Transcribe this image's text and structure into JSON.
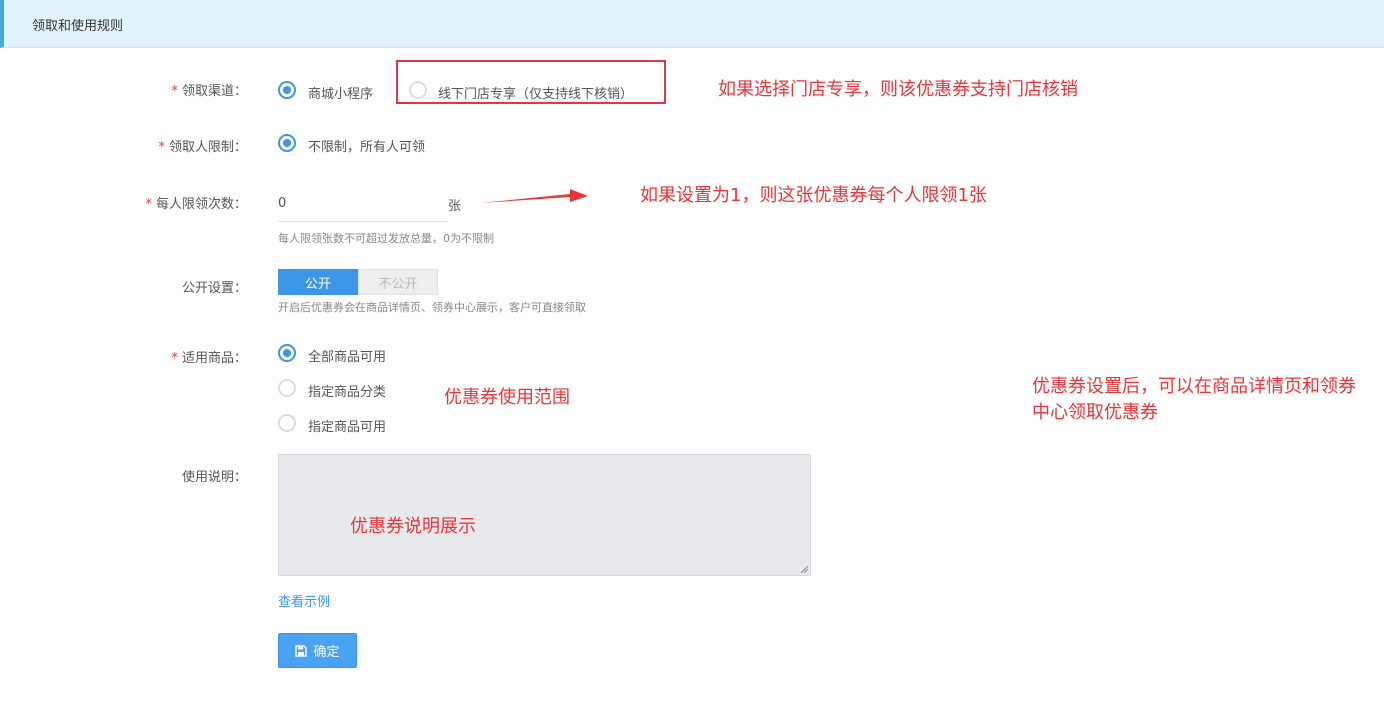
{
  "section": {
    "title": "领取和使用规则"
  },
  "channel": {
    "label": "领取渠道：",
    "options": [
      "商城小程序",
      "线下门店专享（仅支持线下核销）"
    ],
    "selected": "商城小程序"
  },
  "claimant": {
    "label": "领取人限制：",
    "options": [
      "不限制，所有人可领"
    ],
    "selected": "不限制，所有人可领"
  },
  "per_person": {
    "label": "每人限领次数：",
    "value": "0",
    "unit": "张",
    "hint": "每人限领张数不可超过发放总量，0为不限制"
  },
  "public": {
    "label": "公开设置：",
    "on_label": "公开",
    "off_label": "不公开",
    "selected": "公开",
    "hint": "开启后优惠券会在商品详情页、领券中心展示，客户可直接领取"
  },
  "goods": {
    "label": "适用商品：",
    "options": [
      "全部商品可用",
      "指定商品分类",
      "指定商品可用"
    ],
    "selected": "全部商品可用"
  },
  "usage": {
    "label": "使用说明：",
    "example_link": "查看示例"
  },
  "submit": {
    "label": "确定",
    "icon": "save-icon"
  },
  "required_mark": "*",
  "annotations": {
    "store_exclusive": "如果选择门店专享，则该优惠券支持门店核销",
    "limit_one": "如果设置为1，则这张优惠券每个人限领1张",
    "scope": "优惠券使用范围",
    "public_desc_line1": "优惠券设置后，可以在商品详情页和领券",
    "public_desc_line2": "中心领取优惠券",
    "description": "优惠券说明展示"
  },
  "colors": {
    "accent": "#3d95e8",
    "annotation_red": "#e8353a",
    "header_bg": "#dff3f8"
  }
}
